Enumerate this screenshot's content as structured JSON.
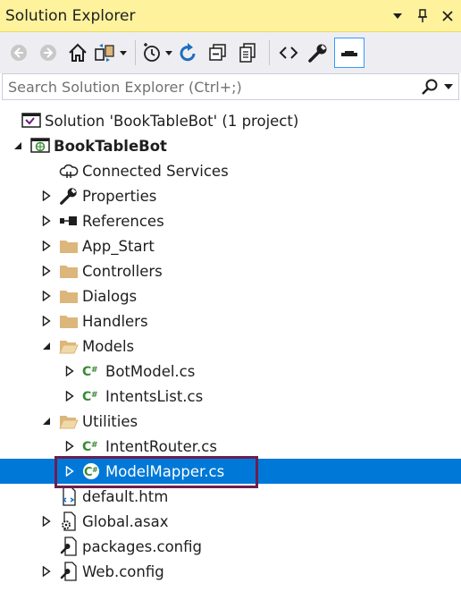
{
  "window": {
    "title": "Solution Explorer",
    "title_buttons": [
      "dropdown-icon",
      "pin-icon",
      "close-icon"
    ]
  },
  "toolbar": {
    "tools": [
      "back-icon",
      "forward-icon",
      "home-icon",
      "switch-views-icon",
      "pending-changes-icon",
      "refresh-icon",
      "collapse-all-icon",
      "show-all-files-icon",
      "view-code-icon",
      "properties-icon",
      "preview-selected-icon"
    ]
  },
  "search": {
    "placeholder": "Search Solution Explorer (Ctrl+;)"
  },
  "tree": {
    "solution": "Solution 'BookTableBot' (1 project)",
    "project": "BookTableBot",
    "items": [
      {
        "label": "Connected Services"
      },
      {
        "label": "Properties"
      },
      {
        "label": "References"
      },
      {
        "label": "App_Start"
      },
      {
        "label": "Controllers"
      },
      {
        "label": "Dialogs"
      },
      {
        "label": "Handlers"
      },
      {
        "label": "Models"
      },
      {
        "label": "BotModel.cs"
      },
      {
        "label": "IntentsList.cs"
      },
      {
        "label": "Utilities"
      },
      {
        "label": "IntentRouter.cs"
      },
      {
        "label": "ModelMapper.cs"
      },
      {
        "label": "default.htm"
      },
      {
        "label": "Global.asax"
      },
      {
        "label": "packages.config"
      },
      {
        "label": "Web.config"
      }
    ]
  },
  "colors": {
    "title_bar": "#fff29d",
    "toolbar": "#eeeef2",
    "selection": "#0078d7",
    "highlight_box": "#6b1e4f",
    "csharp_green": "#388a34",
    "folder": "#dcb67a"
  }
}
